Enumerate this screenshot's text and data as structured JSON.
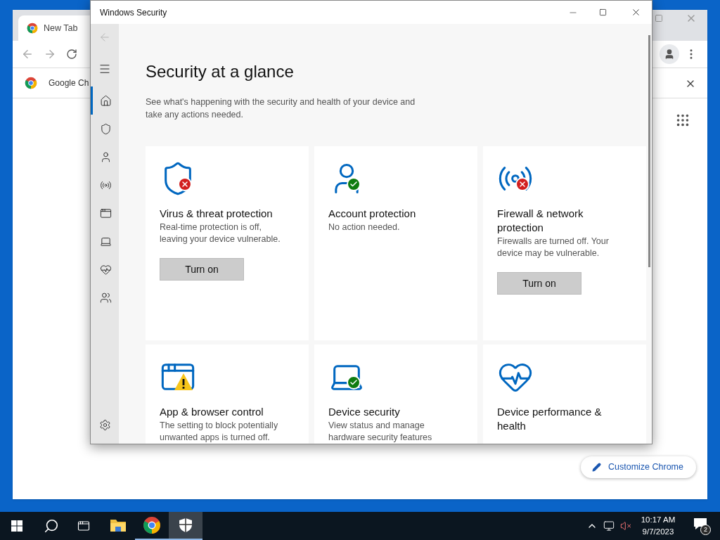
{
  "browser": {
    "tab": {
      "title": "New Tab"
    },
    "bookmark": {
      "label": "Google Ch"
    },
    "customize_button": {
      "label": "Customize Chrome"
    }
  },
  "window": {
    "title": "Windows Security"
  },
  "back_button": {
    "disabled": true
  },
  "sidebar": {
    "items": [
      {
        "selected": true
      },
      {
        "selected": false
      },
      {
        "selected": false
      },
      {
        "selected": false
      },
      {
        "selected": false
      },
      {
        "selected": false
      },
      {
        "selected": false
      },
      {
        "selected": false
      }
    ]
  },
  "page": {
    "title": "Security at a glance",
    "subtitle": "See what's happening with the security and health of your device and take any actions needed."
  },
  "cards": [
    {
      "kind": "shield",
      "badge": {
        "kind": "error"
      },
      "title": "Virus & threat protection",
      "description": "Real-time protection is off, leaving your device vulnerable.",
      "button": "Turn on"
    },
    {
      "kind": "person",
      "badge": {
        "kind": "ok"
      },
      "title": "Account protection",
      "description": "No action needed."
    },
    {
      "kind": "antenna",
      "badge": {
        "kind": "error"
      },
      "title": "Firewall & network protection",
      "description": "Firewalls are turned off. Your device may be vulnerable.",
      "button": "Turn on"
    },
    {
      "kind": "window",
      "badge": {
        "kind": "warning"
      },
      "title": "App & browser control",
      "description": "The setting to block potentially unwanted apps is turned off."
    },
    {
      "kind": "laptop",
      "badge": {
        "kind": "ok"
      },
      "title": "Device security",
      "description": "View status and manage hardware security features"
    },
    {
      "kind": "heart",
      "title": "Device performance & health"
    }
  ],
  "taskbar": {
    "apps": [
      {
        "running": false,
        "selected": false
      },
      {
        "running": true,
        "selected": false
      },
      {
        "running": true,
        "selected": true
      }
    ],
    "clock": {
      "time": "10:17 AM",
      "date": "9/7/2023"
    },
    "notifications": "2"
  }
}
